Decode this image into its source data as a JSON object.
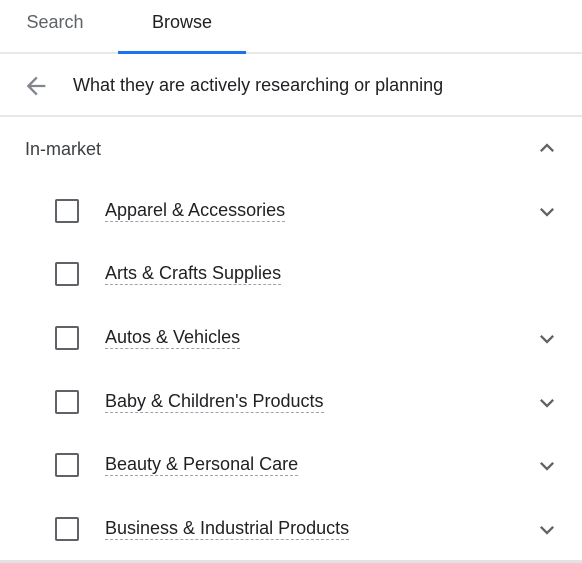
{
  "tabs": [
    {
      "label": "Search",
      "active": false
    },
    {
      "label": "Browse",
      "active": true
    }
  ],
  "accent_color": "#1a73e8",
  "header": {
    "back_icon": "arrow-left-icon",
    "title": "What they are actively researching or planning"
  },
  "section": {
    "title": "In-market",
    "expanded": true,
    "toggle_icon": "chevron-up-icon"
  },
  "items": [
    {
      "label": "Apparel & Accessories",
      "checked": false,
      "expandable": true
    },
    {
      "label": "Arts & Crafts Supplies",
      "checked": false,
      "expandable": false
    },
    {
      "label": "Autos & Vehicles",
      "checked": false,
      "expandable": true
    },
    {
      "label": "Baby & Children's Products",
      "checked": false,
      "expandable": true
    },
    {
      "label": "Beauty & Personal Care",
      "checked": false,
      "expandable": true
    },
    {
      "label": "Business & Industrial Products",
      "checked": false,
      "expandable": true
    }
  ]
}
